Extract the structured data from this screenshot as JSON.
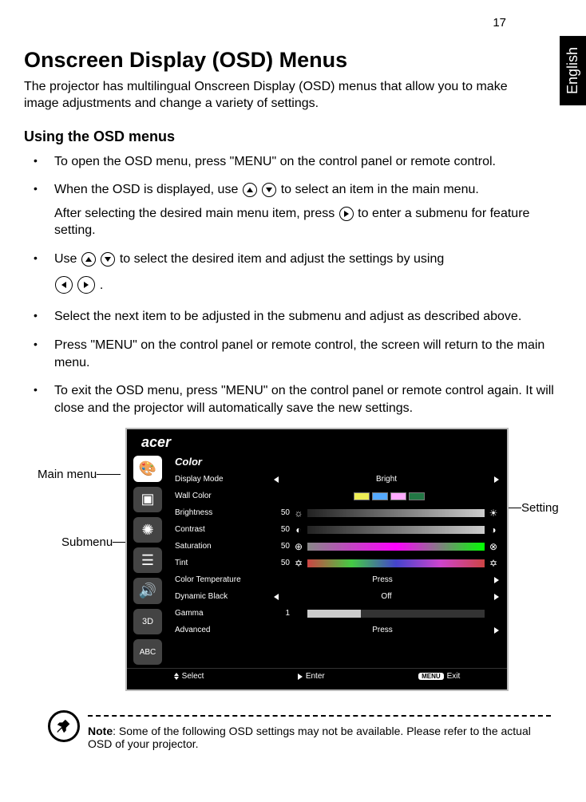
{
  "page_number": "17",
  "lang_tab": "English",
  "title": "Onscreen Display (OSD) Menus",
  "intro": "The projector has multilingual Onscreen Display (OSD) menus that allow you to make image adjustments and change a variety of settings.",
  "subtitle": "Using the OSD menus",
  "bullets": {
    "b1": "To open the OSD menu, press \"MENU\" on the control panel or remote control.",
    "b2a": "When the OSD is displayed, use ",
    "b2b": " to select an item in the main menu.",
    "b2c": "After selecting the desired main menu item, press ",
    "b2d": " to enter a submenu for feature setting.",
    "b3a": "Use ",
    "b3b": " to select the desired item and adjust the settings by using ",
    "b3c": ".",
    "b4": "Select the next item to be adjusted in the submenu and adjust as described above.",
    "b5": "Press \"MENU\" on the control panel or remote control, the screen will return to the main menu.",
    "b6": "To exit the OSD menu, press \"MENU\" on the control panel or remote control again. It will close and the projector will automatically save the new settings."
  },
  "osd": {
    "brand": "acer",
    "panel_title": "Color",
    "rows": {
      "display_mode": {
        "label": "Display Mode",
        "value": "Bright"
      },
      "wall_color": {
        "label": "Wall Color"
      },
      "brightness": {
        "label": "Brightness",
        "value": "50"
      },
      "contrast": {
        "label": "Contrast",
        "value": "50"
      },
      "saturation": {
        "label": "Saturation",
        "value": "50"
      },
      "tint": {
        "label": "Tint",
        "value": "50"
      },
      "color_temp": {
        "label": "Color Temperature",
        "value": "Press"
      },
      "dynamic_black": {
        "label": "Dynamic Black",
        "value": "Off"
      },
      "gamma": {
        "label": "Gamma",
        "value": "1"
      },
      "advanced": {
        "label": "Advanced",
        "value": "Press"
      }
    },
    "footer": {
      "select": "Select",
      "enter": "Enter",
      "exit_badge": "MENU",
      "exit": "Exit"
    },
    "side_badge_3d": "3D"
  },
  "callouts": {
    "main_menu": "Main menu",
    "submenu": "Submenu",
    "setting": "Setting"
  },
  "note": {
    "label": "Note",
    "text": ": Some of the following OSD settings may not be available. Please refer to the actual OSD of your projector."
  }
}
